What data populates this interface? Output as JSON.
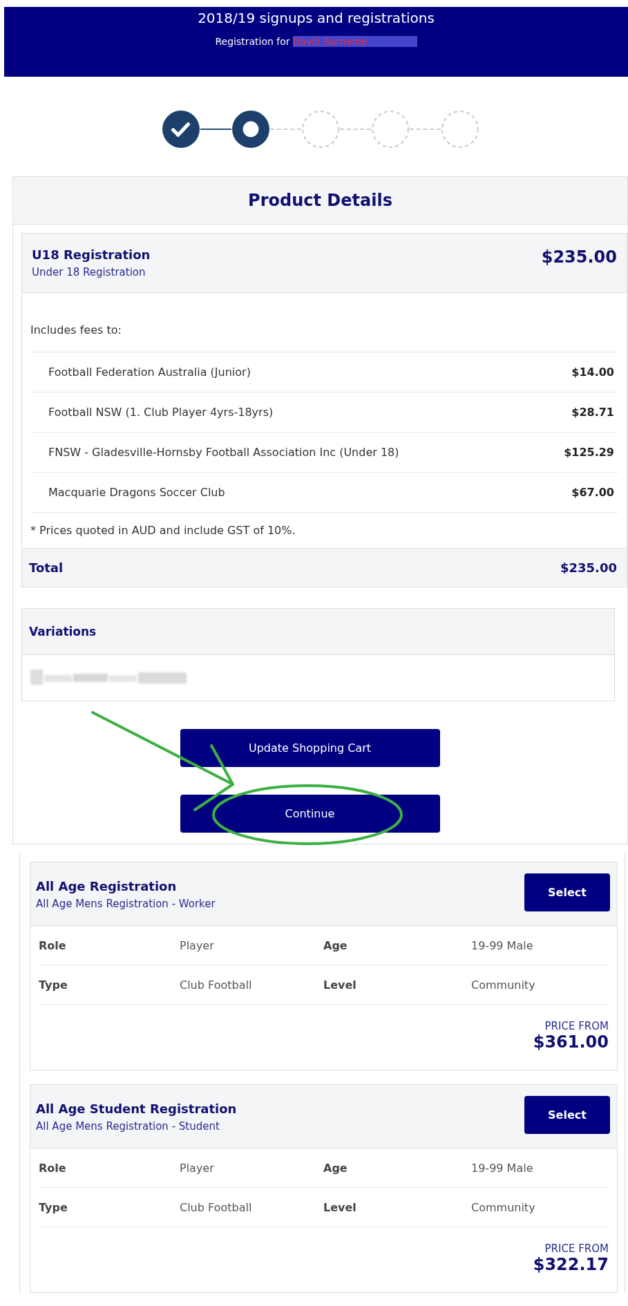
{
  "header": {
    "title": "2018/19 signups and registrations",
    "subtitle": "Registration for",
    "name": "David Surname"
  },
  "steps": [
    {
      "kind": "done"
    },
    {
      "kind": "current"
    },
    {
      "kind": "pending"
    },
    {
      "kind": "pending"
    },
    {
      "kind": "pending"
    }
  ],
  "product": {
    "heading": "Product Details",
    "name": "U18 Registration",
    "description": "Under 18 Registration",
    "price": "$235.00",
    "includes_label": "Includes fees to:",
    "fees": [
      {
        "label": "Football Federation Australia (Junior)",
        "amount": "$14.00"
      },
      {
        "label": "Football NSW (1. Club Player 4yrs-18yrs)",
        "amount": "$28.71"
      },
      {
        "label": "FNSW - Gladesville-Hornsby Football Association Inc (Under 18)",
        "amount": "$125.29"
      },
      {
        "label": "Macquarie Dragons Soccer Club",
        "amount": "$67.00"
      }
    ],
    "note": "* Prices quoted in AUD and include GST of 10%.",
    "total_label": "Total",
    "total": "$235.00"
  },
  "variations": {
    "heading": "Variations"
  },
  "buttons": [
    {
      "label": "Update Shopping Cart",
      "circled": false
    },
    {
      "label": "Continue",
      "circled": true
    }
  ],
  "offers": [
    {
      "name": "All Age Registration",
      "description": "All Age Mens Registration - Worker",
      "button": "Select",
      "details": [
        [
          "Role",
          "Player",
          "Age",
          "19-99 Male"
        ],
        [
          "Type",
          "Club Football",
          "Level",
          "Community"
        ]
      ],
      "price_label": "PRICE FROM",
      "price": "$361.00"
    },
    {
      "name": "All Age Student Registration",
      "description": "All Age Mens Registration - Student",
      "button": "Select",
      "details": [
        [
          "Role",
          "Player",
          "Age",
          "19-99 Male"
        ],
        [
          "Type",
          "Club Football",
          "Level",
          "Community"
        ]
      ],
      "price_label": "PRICE FROM",
      "price": "$322.17"
    }
  ]
}
